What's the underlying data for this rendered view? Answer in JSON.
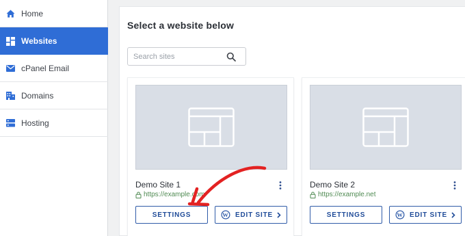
{
  "sidebar": {
    "items": [
      {
        "label": "Home",
        "icon": "home-icon",
        "active": false
      },
      {
        "label": "Websites",
        "icon": "websites-grid-icon",
        "active": true
      },
      {
        "label": "cPanel Email",
        "icon": "envelope-icon",
        "active": false
      },
      {
        "label": "Domains",
        "icon": "building-icon",
        "active": false
      },
      {
        "label": "Hosting",
        "icon": "server-icon",
        "active": false
      }
    ]
  },
  "main": {
    "title": "Select a website below",
    "search": {
      "placeholder": "Search sites",
      "value": ""
    },
    "sites": [
      {
        "name": "Demo Site 1",
        "url": "https://example.com",
        "settings_label": "SETTINGS",
        "edit_label": "EDIT SITE"
      },
      {
        "name": "Demo Site 2",
        "url": "https://example.net",
        "settings_label": "SETTINGS",
        "edit_label": "EDIT SITE"
      }
    ]
  },
  "colors": {
    "accent": "#2f6dd6",
    "button_border": "#2f5ba8",
    "url_green": "#4f8a52",
    "annotation_red": "#e32222"
  }
}
